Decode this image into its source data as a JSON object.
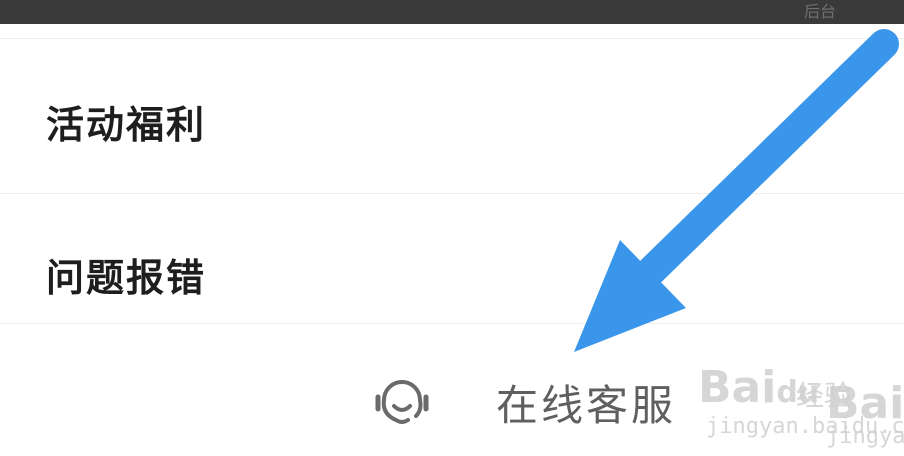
{
  "header": {
    "partial_text": "后台"
  },
  "menu": {
    "items": [
      {
        "label": "活动福利"
      },
      {
        "label": "问题报错"
      }
    ]
  },
  "support": {
    "label": "在线客服",
    "icon": "headset-icon"
  },
  "watermark": {
    "brand": "Bai",
    "brand_sub": "du",
    "brand_cn": "经验",
    "url": "jingyan.baidu.com",
    "brand_right": "Bai",
    "url_right": "jingyan"
  },
  "colors": {
    "arrow": "#3a96ea",
    "top_bar": "#3a3a3a",
    "label": "#1e1e1e",
    "support_text": "#5f5f5f"
  }
}
